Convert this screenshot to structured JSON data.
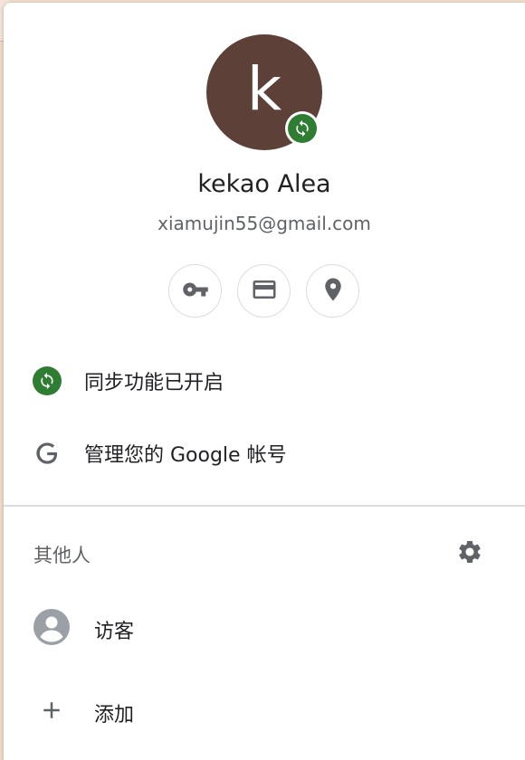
{
  "profile": {
    "avatar_letter": "k",
    "name": "kekao Alea",
    "email": "xiamujin55@gmail.com"
  },
  "quick_actions": [
    {
      "icon": "key-icon",
      "label": "Passwords"
    },
    {
      "icon": "credit-card-icon",
      "label": "Payment methods"
    },
    {
      "icon": "location-pin-icon",
      "label": "Addresses"
    }
  ],
  "menu": {
    "sync_label": "同步功能已开启",
    "manage_account_label": "管理您的 Google 帐号"
  },
  "others": {
    "title": "其他人",
    "guest_label": "访客",
    "add_label": "添加"
  },
  "colors": {
    "avatar_bg": "#5d4037",
    "sync_green": "#2e7d32",
    "icon_grey": "#5f6368"
  }
}
